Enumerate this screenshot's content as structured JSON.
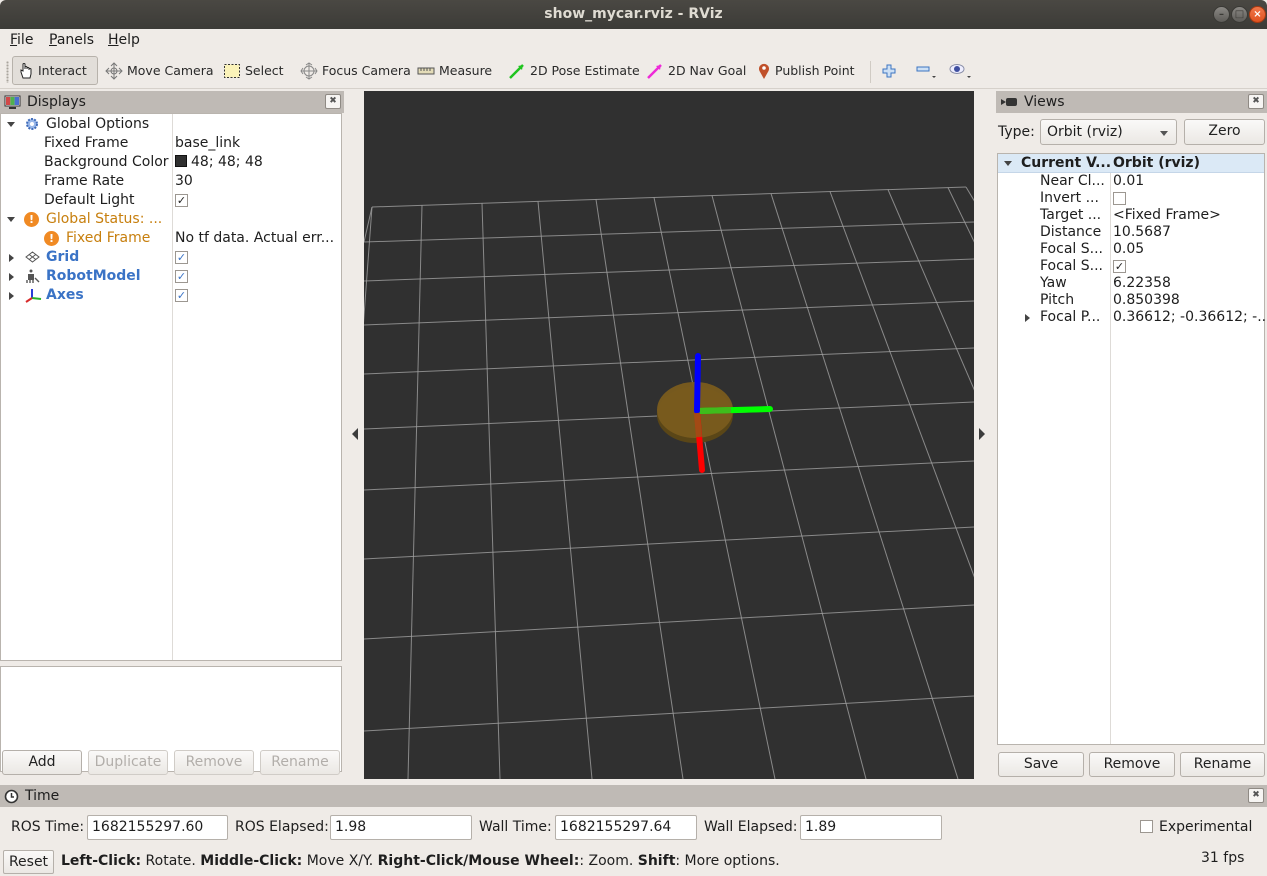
{
  "window": {
    "title": "show_mycar.rviz - RViz",
    "controls": [
      "minimize",
      "maximize",
      "close"
    ]
  },
  "menu": {
    "items": [
      {
        "label": "File",
        "mnemonic": "F"
      },
      {
        "label": "Panels",
        "mnemonic": "P"
      },
      {
        "label": "Help",
        "mnemonic": "H"
      }
    ]
  },
  "toolbar": {
    "tools": [
      {
        "label": "Interact",
        "icon": "hand-pointer-icon",
        "active": true
      },
      {
        "label": "Move Camera",
        "icon": "move-arrows-icon",
        "active": false
      },
      {
        "label": "Select",
        "icon": "select-rect-icon",
        "active": false
      },
      {
        "label": "Focus Camera",
        "icon": "crosshair-icon",
        "active": false
      },
      {
        "label": "Measure",
        "icon": "ruler-icon",
        "active": false
      },
      {
        "label": "2D Pose Estimate",
        "icon": "green-arrow-icon",
        "active": false
      },
      {
        "label": "2D Nav Goal",
        "icon": "magenta-arrow-icon",
        "active": false
      },
      {
        "label": "Publish Point",
        "icon": "map-pin-icon",
        "active": false
      }
    ],
    "extra_icons": [
      "plus-icon",
      "minus-icon",
      "eye-icon"
    ]
  },
  "displays": {
    "title": "Displays",
    "global_options": {
      "label": "Global Options",
      "fixed_frame_label": "Fixed Frame",
      "fixed_frame_value": "base_link",
      "background_color_label": "Background Color",
      "background_color_value": "48; 48; 48",
      "background_color_hex": "#303030",
      "frame_rate_label": "Frame Rate",
      "frame_rate_value": "30",
      "default_light_label": "Default Light",
      "default_light_checked": true
    },
    "global_status": {
      "label": "Global Status: ...",
      "fixed_frame_label": "Fixed Frame",
      "fixed_frame_value": "No tf data.  Actual err..."
    },
    "items": [
      {
        "label": "Grid",
        "checked": true
      },
      {
        "label": "RobotModel",
        "checked": true
      },
      {
        "label": "Axes",
        "checked": true
      }
    ],
    "buttons": {
      "add": "Add",
      "duplicate": "Duplicate",
      "remove": "Remove",
      "rename": "Rename"
    }
  },
  "views": {
    "title": "Views",
    "type_label": "Type:",
    "type_value": "Orbit (rviz)",
    "zero_label": "Zero",
    "current_view_label": "Current V...",
    "current_view_value": "Orbit (rviz)",
    "properties": [
      {
        "label": "Near Cl...",
        "value": "0.01"
      },
      {
        "label": "Invert ...",
        "value": "",
        "checkbox": false
      },
      {
        "label": "Target ...",
        "value": "<Fixed Frame>"
      },
      {
        "label": "Distance",
        "value": "10.5687"
      },
      {
        "label": "Focal S...",
        "value": "0.05"
      },
      {
        "label": "Focal S...",
        "value": "",
        "checkbox": true
      },
      {
        "label": "Yaw",
        "value": "6.22358"
      },
      {
        "label": "Pitch",
        "value": "0.850398"
      },
      {
        "label": "Focal P...",
        "value": "0.36612; -0.36612; -...",
        "expandable": true
      }
    ],
    "buttons": {
      "save": "Save",
      "remove": "Remove",
      "rename": "Rename"
    }
  },
  "time": {
    "title": "Time",
    "ros_time_label": "ROS Time:",
    "ros_time_value": "1682155297.60",
    "ros_elapsed_label": "ROS Elapsed:",
    "ros_elapsed_value": "1.98",
    "wall_time_label": "Wall Time:",
    "wall_time_value": "1682155297.64",
    "wall_elapsed_label": "Wall Elapsed:",
    "wall_elapsed_value": "1.89",
    "experimental_label": "Experimental",
    "experimental_checked": false
  },
  "status": {
    "reset_label": "Reset",
    "hint": [
      {
        "bold": "Left-Click:",
        "text": " Rotate. "
      },
      {
        "bold": "Middle-Click:",
        "text": " Move X/Y. "
      },
      {
        "bold": "Right-Click/Mouse Wheel:",
        "text": ": Zoom. "
      },
      {
        "bold": "Shift",
        "text": ": More options."
      }
    ],
    "fps": "31 fps"
  },
  "scene": {
    "background": "#303030",
    "grid_color": "#a0a0a0",
    "axis_colors": {
      "x": "#ff0000",
      "y": "#00ff00",
      "z": "#0000ff"
    },
    "robot_color": "#7a5c1e"
  }
}
